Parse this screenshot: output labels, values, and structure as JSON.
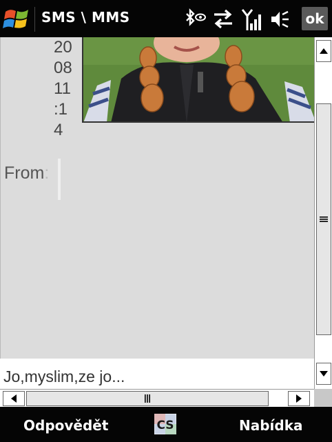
{
  "title_bar": {
    "title": "SMS \\ MMS",
    "ok_label": "ok",
    "icons": [
      "windows-start-icon",
      "bluetooth-icon",
      "data-connection-icon",
      "signal-strength-icon",
      "volume-icon"
    ]
  },
  "message": {
    "date_lines": [
      "20",
      "08",
      "11",
      ":1",
      "4"
    ],
    "from_label": "From",
    "from_colon": ":",
    "preview_text": "Jo,myslim,ze jo..."
  },
  "softkeys": {
    "left_label": "Odpovědět",
    "input_method_label": "CS",
    "right_label": "Nabídka"
  },
  "colors": {
    "bar_background": "#050505",
    "content_background": "#dcdcdc",
    "scroll_thumb": "#e6e6e6"
  }
}
